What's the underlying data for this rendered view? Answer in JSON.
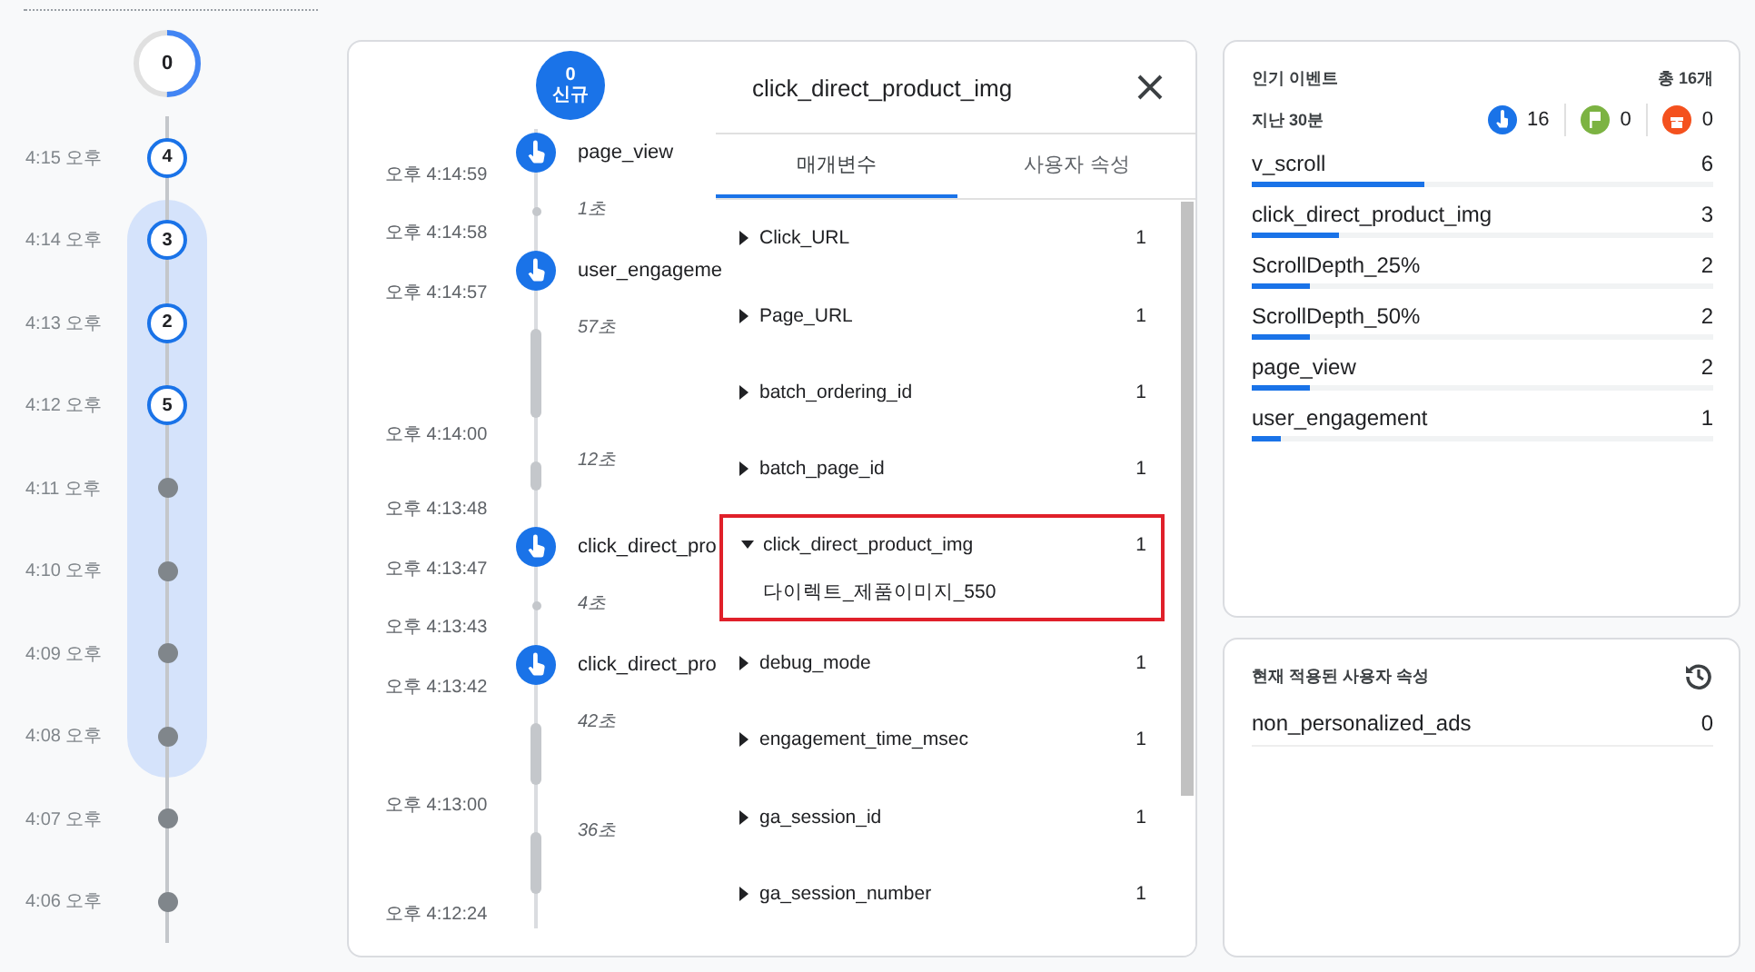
{
  "minutes": {
    "current": {
      "count": "0"
    },
    "rows": [
      {
        "time": "4:15 오후",
        "count": "4",
        "selected": false
      },
      {
        "time": "4:14 오후",
        "count": "3",
        "selected": true
      },
      {
        "time": "4:13 오후",
        "count": "2",
        "selected": true
      },
      {
        "time": "4:12 오후",
        "count": "5",
        "selected": true
      },
      {
        "time": "4:11 오후",
        "selected": true
      },
      {
        "time": "4:10 오후",
        "selected": true
      },
      {
        "time": "4:09 오후",
        "selected": true
      },
      {
        "time": "4:08 오후",
        "selected": true
      },
      {
        "time": "4:07 오후",
        "selected": false
      },
      {
        "time": "4:06 오후",
        "selected": false
      }
    ]
  },
  "stream": {
    "new_count": "0",
    "new_label": "신규",
    "segments": [
      {
        "kind": "event",
        "name": "page_view",
        "time": "오후 4:14:59"
      },
      {
        "kind": "dot",
        "duration": "1초",
        "time": "오후 4:14:58"
      },
      {
        "kind": "event",
        "name": "user_engageme",
        "time": "오후 4:14:57"
      },
      {
        "kind": "long",
        "duration": "57초",
        "time": "오후 4:14:00"
      },
      {
        "kind": "short",
        "duration": "12초",
        "time": "오후 4:13:48"
      },
      {
        "kind": "event",
        "name": "click_direct_pro",
        "time": "오후 4:13:47"
      },
      {
        "kind": "dot",
        "duration": "4초",
        "time": "오후 4:13:43"
      },
      {
        "kind": "event",
        "name": "click_direct_pro",
        "time": "오후 4:13:42"
      },
      {
        "kind": "medium",
        "duration": "42초",
        "time": "오후 4:13:00"
      },
      {
        "kind": "medium",
        "duration": "36초",
        "time": "오후 4:12:24"
      }
    ]
  },
  "detail": {
    "title": "click_direct_product_img",
    "tabs": [
      {
        "label": "매개변수",
        "selected": true
      },
      {
        "label": "사용자 속성",
        "selected": false
      }
    ],
    "params": [
      {
        "name": "Click_URL",
        "count": "1",
        "expanded": false
      },
      {
        "name": "Page_URL",
        "count": "1",
        "expanded": false
      },
      {
        "name": "batch_ordering_id",
        "count": "1",
        "expanded": false
      },
      {
        "name": "batch_page_id",
        "count": "1",
        "expanded": false
      },
      {
        "name": "click_direct_product_img",
        "count": "1",
        "expanded": true,
        "value": "다이렉트_제품이미지_550",
        "highlighted": true
      },
      {
        "name": "debug_mode",
        "count": "1",
        "expanded": false
      },
      {
        "name": "engagement_time_msec",
        "count": "1",
        "expanded": false
      },
      {
        "name": "ga_session_id",
        "count": "1",
        "expanded": false
      },
      {
        "name": "ga_session_number",
        "count": "1",
        "expanded": false
      }
    ]
  },
  "top_events": {
    "title": "인기 이벤트",
    "total": "총 16개",
    "period": "지난 30분",
    "stats": [
      {
        "kind": "event",
        "count": "16",
        "color": "#1a73e8"
      },
      {
        "kind": "conversion",
        "count": "0",
        "color": "#7cb342"
      },
      {
        "kind": "error",
        "count": "0",
        "color": "#f4511e"
      }
    ],
    "events": [
      {
        "name": "v_scroll",
        "count": "6",
        "level": 0.375
      },
      {
        "name": "click_direct_product_img",
        "count": "3",
        "level": 0.1875
      },
      {
        "name": "ScrollDepth_25%",
        "count": "2",
        "level": 0.125
      },
      {
        "name": "ScrollDepth_50%",
        "count": "2",
        "level": 0.125
      },
      {
        "name": "page_view",
        "count": "2",
        "level": 0.125
      },
      {
        "name": "user_engagement",
        "count": "1",
        "level": 0.0625
      }
    ]
  },
  "user_properties": {
    "title": "현재 적용된 사용자 속성",
    "rows": [
      {
        "name": "non_personalized_ads",
        "value": "0"
      }
    ]
  }
}
